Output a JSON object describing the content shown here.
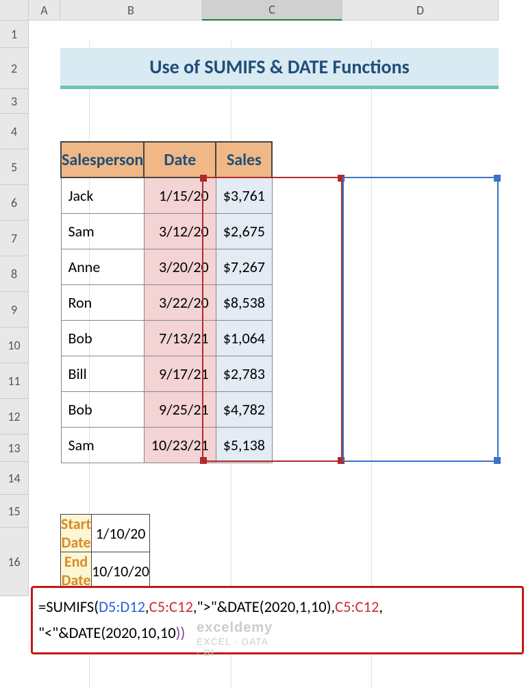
{
  "columns": [
    "A",
    "B",
    "C",
    "D"
  ],
  "rows": [
    "1",
    "2",
    "3",
    "4",
    "5",
    "6",
    "7",
    "8",
    "9",
    "10",
    "11",
    "12",
    "13",
    "14",
    "15",
    "16"
  ],
  "selected_col": "C",
  "title": "Use of SUMIFS & DATE Functions",
  "table": {
    "headers": [
      "Salesperson",
      "Date",
      "Sales"
    ],
    "rows": [
      {
        "sp": "Jack",
        "date": "1/15/20",
        "cur": "$",
        "sales": "3,761"
      },
      {
        "sp": "Sam",
        "date": "3/12/20",
        "cur": "$",
        "sales": "2,675"
      },
      {
        "sp": "Anne",
        "date": "3/20/20",
        "cur": "$",
        "sales": "7,267"
      },
      {
        "sp": "Ron",
        "date": "3/22/20",
        "cur": "$",
        "sales": "8,538"
      },
      {
        "sp": "Bob",
        "date": "7/13/21",
        "cur": "$",
        "sales": "1,064"
      },
      {
        "sp": "Bill",
        "date": "9/17/21",
        "cur": "$",
        "sales": "2,783"
      },
      {
        "sp": "Bob",
        "date": "9/25/21",
        "cur": "$",
        "sales": "4,782"
      },
      {
        "sp": "Sam",
        "date": "10/23/21",
        "cur": "$",
        "sales": "5,138"
      }
    ]
  },
  "dates": {
    "start_label": "Start Date",
    "start_val": "1/10/20",
    "end_label": "End Date",
    "end_val": "10/10/20"
  },
  "formula": {
    "p1": "=SUMIFS(",
    "p2": "D5:D12",
    "p3": ",",
    "p4": "C5:C12",
    "p5": ",\">\"&DATE(",
    "p6": "2020,1,10",
    "p7": "),",
    "p8": "C5:C12",
    "p9": ",",
    "p10": "\"<\"&DATE(",
    "p11": "2020,10,10",
    "p12": "))"
  },
  "watermark": {
    "big": "exceldemy",
    "small": "EXCEL · DATA · BI"
  },
  "chart_data": {
    "type": "table",
    "title": "Use of SUMIFS & DATE Functions",
    "columns": [
      "Salesperson",
      "Date",
      "Sales"
    ],
    "rows": [
      [
        "Jack",
        "1/15/20",
        3761
      ],
      [
        "Sam",
        "3/12/20",
        2675
      ],
      [
        "Anne",
        "3/20/20",
        7267
      ],
      [
        "Ron",
        "3/22/20",
        8538
      ],
      [
        "Bob",
        "7/13/21",
        1064
      ],
      [
        "Bill",
        "9/17/21",
        2783
      ],
      [
        "Bob",
        "9/25/21",
        4782
      ],
      [
        "Sam",
        "10/23/21",
        5138
      ]
    ],
    "criteria": {
      "start_date": "1/10/20",
      "end_date": "10/10/20"
    },
    "formula": "=SUMIFS(D5:D12,C5:C12,\">\"&DATE(2020,1,10),C5:C12,\"<\"&DATE(2020,10,10))"
  }
}
